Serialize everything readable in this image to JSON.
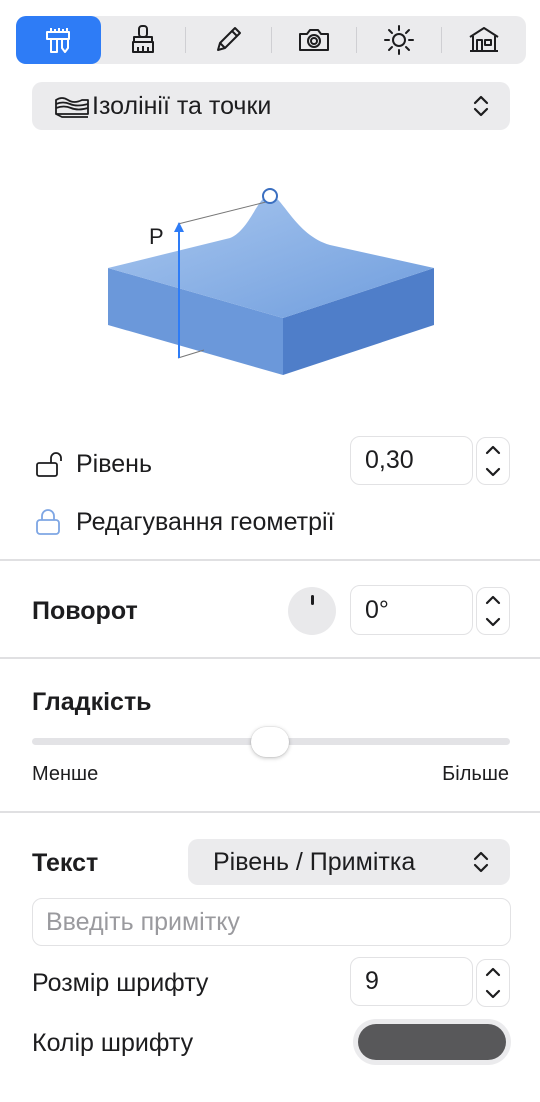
{
  "toolbar": {
    "tools": [
      {
        "icon": "ruler-caliper-icon",
        "active": true
      },
      {
        "icon": "paint-brush-icon",
        "active": false
      },
      {
        "icon": "pencil-icon",
        "active": false
      },
      {
        "icon": "camera-icon",
        "active": false
      },
      {
        "icon": "sun-icon",
        "active": false
      },
      {
        "icon": "building-icon",
        "active": false
      }
    ]
  },
  "mode_popup": {
    "icon": "contour-layers-icon",
    "label": "Ізолінії та точки"
  },
  "illustration": {
    "height_label": "P"
  },
  "level": {
    "label": "Рівень",
    "value": "0,30",
    "lock_icon": "lock-open-icon"
  },
  "edit_geometry": {
    "label": "Редагування геометрії",
    "lock_icon": "lock-icon"
  },
  "rotation": {
    "label": "Поворот",
    "value": "0°"
  },
  "smoothness": {
    "label": "Гладкість",
    "min_label": "Менше",
    "max_label": "Більше",
    "value_fraction": 0.5
  },
  "text": {
    "label": "Текст",
    "popup_value": "Рівень / Примітка",
    "note_placeholder": "Введіть примітку"
  },
  "font_size": {
    "label": "Розмір шрифту",
    "value": "9"
  },
  "font_color": {
    "label": "Колір шрифту",
    "color": "#58585a"
  },
  "colors": {
    "accent": "#2e7cf6",
    "terrain_top": "#8fb4e6",
    "terrain_side_left": "#6b98da",
    "terrain_side_right": "#4f7ec9"
  }
}
